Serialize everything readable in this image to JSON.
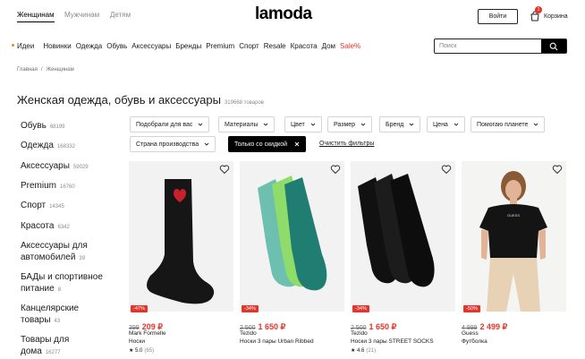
{
  "header": {
    "genders": [
      "Женщинам",
      "Мужчинам",
      "Детям"
    ],
    "logo": "lamoda",
    "login": "Войти",
    "cart_label": "Корзина",
    "cart_count": "1"
  },
  "nav": {
    "items": [
      "Идеи",
      "Новинки",
      "Одежда",
      "Обувь",
      "Аксессуары",
      "Бренды",
      "Premium",
      "Спорт",
      "Resale",
      "Красота",
      "Дом"
    ],
    "sale": "Sale%"
  },
  "search": {
    "placeholder": "Поиск"
  },
  "breadcrumb": {
    "home": "Главная",
    "sep": "/",
    "current": "Женщинам"
  },
  "page": {
    "title": "Женская одежда, обувь и аксессуары",
    "count": "319668 товаров"
  },
  "sidebar": {
    "items": [
      {
        "label": "Обувь",
        "count": "68199"
      },
      {
        "label": "Одежда",
        "count": "168332"
      },
      {
        "label": "Аксессуары",
        "count": "59029"
      },
      {
        "label": "Premium",
        "count": "16760"
      },
      {
        "label": "Спорт",
        "count": "14345"
      },
      {
        "label": "Красота",
        "count": "6342"
      },
      {
        "label": "Аксессуары для автомобилей",
        "line1": "Аксессуары для",
        "line2": "автомобилей",
        "count": "39"
      },
      {
        "label": "БАДы и спортивное питание",
        "line1": "БАДы и спортивное",
        "line2": "питание",
        "count": "8"
      },
      {
        "label": "Канцелярские товары",
        "line1": "Канцелярские",
        "line2": "товары",
        "count": "43"
      },
      {
        "label": "Товары для дома",
        "line1": "Товары для",
        "line2": "дома",
        "count": "16277"
      }
    ]
  },
  "filters": {
    "row1": [
      "Подобрали для вас",
      "Материалы",
      "Цвет",
      "Размер",
      "Бренд",
      "Цена",
      "Помогаю планете"
    ],
    "country": "Страна производства",
    "active": "Только со скидкой",
    "clear": "Очистить фильтры"
  },
  "products": [
    {
      "discount": "-47%",
      "old_price": "399",
      "price": "209 ₽",
      "brand": "Mark Formelle",
      "name": "Носки",
      "rating": "5.0",
      "reviews": "(65)"
    },
    {
      "discount": "-34%",
      "old_price": "2 500",
      "price": "1 650 ₽",
      "brand": "Tezido",
      "name": "Носки 3 пары Urban Ribbed",
      "rating": "",
      "reviews": ""
    },
    {
      "discount": "-34%",
      "old_price": "2 500",
      "price": "1 650 ₽",
      "brand": "Tezido",
      "name": "Носки 3 пары STREET SOCKS",
      "rating": "4.6",
      "reviews": "(21)"
    },
    {
      "discount": "-50%",
      "old_price": "4 999",
      "price": "2 499 ₽",
      "brand": "Guess",
      "name": "Футболка",
      "rating": "",
      "reviews": ""
    }
  ]
}
